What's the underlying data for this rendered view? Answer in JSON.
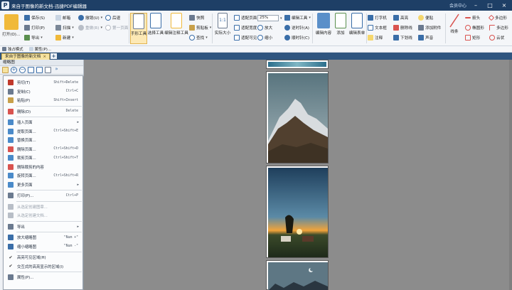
{
  "app": {
    "title": "来自于图像的新文档-迅捷PDF编辑器",
    "member": "会员中心"
  },
  "colors": {
    "titlebar": "#1e3f66",
    "tabbar": "#2f557f",
    "active_tab": "#f6e3a0",
    "canvas": "#8c8c8c"
  },
  "ribbon": {
    "open": "打开(O)...",
    "save": "保存(S)",
    "print": "打印(P)",
    "export": "导出",
    "email": "邮箱",
    "scan": "扫描",
    "new": "新建",
    "undo": "撤销(U)",
    "redo": "重做(R)",
    "back": "后退",
    "first_page": "第一页面",
    "hand_tool": "手形工具",
    "select_tool": "选择工具",
    "edit_annotation_tool": "编辑注释工具",
    "snapshot": "快照",
    "clipboard": "剪贴板",
    "find": "查找",
    "actual_size": "实际大小",
    "fit_page": "适配页面",
    "fit_width": "适配宽度",
    "fit_visible": "适配可见",
    "zoom_value": "25%",
    "zoom_in": "放大",
    "zoom_out": "缩小",
    "edit_tool": "编辑工具",
    "rotate_left": "逆时针(A)",
    "rotate_right": "顺时针(C)",
    "edit_content": "编辑内容",
    "add": "添加",
    "edit_form": "编辑表单",
    "typewriter": "打字机",
    "textbox": "文本框",
    "note": "注释",
    "highlight": "高亮",
    "strikeout": "删除线",
    "underline": "下划线",
    "callout": "便贴",
    "attach_file": "添加附件",
    "sound": "声音",
    "line": "线条",
    "arrow": "箭头",
    "ellipse": "椭圆形",
    "rectangle": "矩形",
    "polygon": "多边形",
    "polyline": "多边形",
    "cloud": "云状"
  },
  "quickbar": {
    "exclusive_mode": "独占模式",
    "properties": "属性(P)..."
  },
  "doc_tab": {
    "label": "来自于图像的新文档",
    "close": "×"
  },
  "panel": {
    "title": "缩略图"
  },
  "context_menu": {
    "items": [
      {
        "label": "剪切(T)",
        "shortcut": "Shift+Delete",
        "icon": "scissors-icon",
        "color": "#c0392b",
        "disabled": false,
        "arrow": false
      },
      {
        "label": "复制(C)",
        "shortcut": "Ctrl+C",
        "icon": "copy-icon",
        "color": "#6b7a8f",
        "disabled": false,
        "arrow": false
      },
      {
        "label": "粘贴(P)",
        "shortcut": "Shift+Insert",
        "icon": "paste-icon",
        "color": "#c8a04a",
        "disabled": false,
        "arrow": false
      },
      {
        "label": "删除(D)",
        "shortcut": "Delete",
        "icon": "delete-icon",
        "color": "#d9534f",
        "disabled": false,
        "arrow": false
      },
      {
        "label": "插入页面",
        "shortcut": "",
        "icon": "insert-page-icon",
        "color": "#4a8ac9",
        "disabled": false,
        "arrow": true
      },
      {
        "label": "提取页面...",
        "shortcut": "Ctrl+Shift+E",
        "icon": "extract-page-icon",
        "color": "#4a8ac9",
        "disabled": false,
        "arrow": false
      },
      {
        "label": "替换页面...",
        "shortcut": "",
        "icon": "replace-page-icon",
        "color": "#4a8ac9",
        "disabled": false,
        "arrow": false
      },
      {
        "label": "删除页面...",
        "shortcut": "Ctrl+Shift+D",
        "icon": "delete-page-icon",
        "color": "#d9534f",
        "disabled": false,
        "arrow": false
      },
      {
        "label": "裁剪页面...",
        "shortcut": "Ctrl+Shift+T",
        "icon": "crop-page-icon",
        "color": "#4a8ac9",
        "disabled": false,
        "arrow": false
      },
      {
        "label": "删除裁剪的内容",
        "shortcut": "",
        "icon": "delete-cropped-icon",
        "color": "#d9534f",
        "disabled": false,
        "arrow": false
      },
      {
        "label": "旋转页面...",
        "shortcut": "Ctrl+Shift+R",
        "icon": "rotate-page-icon",
        "color": "#4a8ac9",
        "disabled": false,
        "arrow": false
      },
      {
        "label": "更多页面",
        "shortcut": "",
        "icon": "more-pages-icon",
        "color": "#4a8ac9",
        "disabled": false,
        "arrow": true
      },
      {
        "label": "打印(P)...",
        "shortcut": "Ctrl+P",
        "icon": "print-icon",
        "color": "#6b7a8f",
        "disabled": false,
        "arrow": false
      },
      {
        "label": "从选定创建图章...",
        "shortcut": "",
        "icon": "stamp-icon",
        "color": "#b8bec7",
        "disabled": true,
        "arrow": false
      },
      {
        "label": "从选定创建文档...",
        "shortcut": "",
        "icon": "document-icon",
        "color": "#b8bec7",
        "disabled": true,
        "arrow": false
      },
      {
        "label": "导出",
        "shortcut": "",
        "icon": "export-icon",
        "color": "#6b7a8f",
        "disabled": false,
        "arrow": true
      },
      {
        "label": "放大缩略图",
        "shortcut": "\"Num +\"",
        "icon": "zoom-in-icon",
        "color": "#3a6ea8",
        "disabled": false,
        "arrow": false
      },
      {
        "label": "缩小缩略图",
        "shortcut": "\"Num -\"",
        "icon": "zoom-out-icon",
        "color": "#3a6ea8",
        "disabled": false,
        "arrow": false
      },
      {
        "label": "高亮可见区域(H)",
        "shortcut": "",
        "icon": "check-icon",
        "color": "",
        "disabled": false,
        "arrow": false
      },
      {
        "label": "交互式的高亮显示的区域(I)",
        "shortcut": "",
        "icon": "check-icon",
        "color": "",
        "disabled": false,
        "arrow": false
      },
      {
        "label": "属性(P)...",
        "shortcut": "",
        "icon": "properties-icon",
        "color": "#6b7a8f",
        "disabled": false,
        "arrow": false
      }
    ]
  }
}
